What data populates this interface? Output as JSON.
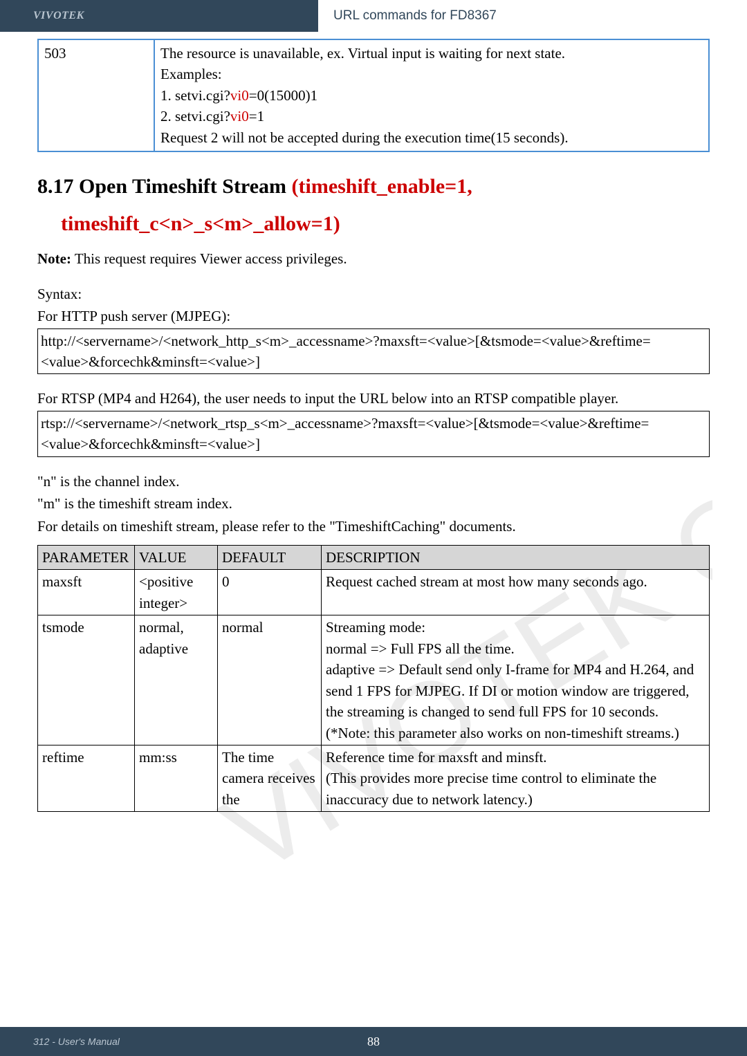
{
  "header": {
    "brand": "VIVOTEK",
    "doc_title": "URL commands for FD8367"
  },
  "table503": {
    "code": "503",
    "lines": [
      {
        "plain": "The resource is unavailable, ex. Virtual input is waiting for next state."
      },
      {
        "plain": "Examples:"
      },
      {
        "pre": "1. setvi.cgi?",
        "red": "vi0",
        "post": "=0(15000)1"
      },
      {
        "pre": "2. setvi.cgi?",
        "red": "vi0",
        "post": "=1"
      },
      {
        "plain": "Request 2 will not be accepted during the execution time(15 seconds)."
      }
    ]
  },
  "section": {
    "num_title_pre": "8.17 Open Timeshift Stream ",
    "num_title_red": "(timeshift_enable=1,",
    "sub_red": "timeshift_c<n>_s<m>_allow=1)"
  },
  "note": {
    "label": "Note:",
    "text": " This request requires Viewer access privileges."
  },
  "syntax1": {
    "heading": "Syntax:",
    "sub": "For HTTP push server (MJPEG):",
    "box": "http://<servername>/<network_http_s<m>_accessname>?maxsft=<value>[&tsmode=<value>&reftime=<value>&forcechk&minsft=<value>]"
  },
  "syntax2": {
    "sub": "For RTSP (MP4 and H264), the user needs to input the URL below into an RTSP compatible player.",
    "box": "rtsp://<servername>/<network_rtsp_s<m>_accessname>?maxsft=<value>[&tsmode=<value>&reftime=<value>&forcechk&minsft=<value>]"
  },
  "notes": {
    "n": "\"n\" is the channel index.",
    "m": "\"m\" is the timeshift stream index.",
    "details": "For details on timeshift stream, please refer to the \"TimeshiftCaching\" documents."
  },
  "param_table": {
    "headers": [
      "PARAMETER",
      "VALUE",
      "DEFAULT",
      "DESCRIPTION"
    ],
    "rows": [
      {
        "p": "maxsft",
        "v": "<positive integer>",
        "d": "0",
        "desc": "Request cached stream at most how many seconds ago."
      },
      {
        "p": "tsmode",
        "v": "normal, adaptive",
        "d": "normal",
        "desc": "Streaming mode:\nnormal => Full FPS all the time.\nadaptive => Default send only I-frame for MP4 and H.264, and send 1 FPS for MJPEG. If DI or motion window are triggered, the streaming is changed to send full FPS for 10 seconds.\n(*Note: this parameter also works on non-timeshift streams.)"
      },
      {
        "p": "reftime",
        "v": "mm:ss",
        "d": "The time camera receives the",
        "desc": "Reference time for maxsft and minsft.\n(This provides more precise time control to eliminate the inaccuracy due to network latency.)"
      }
    ]
  },
  "footer": {
    "left": "312 - User's Manual",
    "page": "88"
  }
}
